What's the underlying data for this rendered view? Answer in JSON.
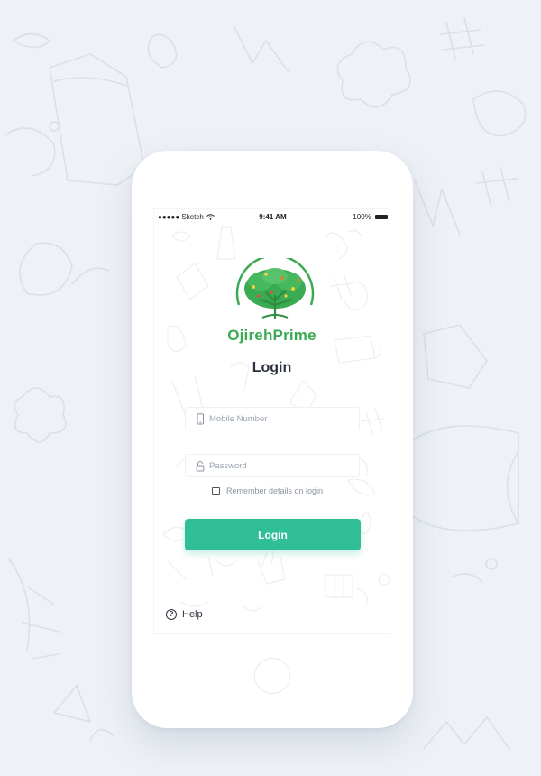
{
  "status_bar": {
    "carrier": "●●●●● Sketch",
    "time": "9:41 AM",
    "battery": "100%"
  },
  "icons": {
    "wifi": "wifi-icon",
    "battery": "battery-icon",
    "phone": "mobile-phone-icon",
    "lock": "lock-icon",
    "help": "question-circle-icon",
    "logo": "tree-logo"
  },
  "brand": {
    "name": "OjirehPrime",
    "color": "#3aab52"
  },
  "login_form": {
    "title": "Login",
    "mobile_placeholder": "Mobile Number",
    "password_placeholder": "Password",
    "remember_label": "Remember details on login",
    "remember_checked": false,
    "submit_label": "Login",
    "submit_color": "#2fbe96"
  },
  "help": {
    "label": "Help"
  }
}
